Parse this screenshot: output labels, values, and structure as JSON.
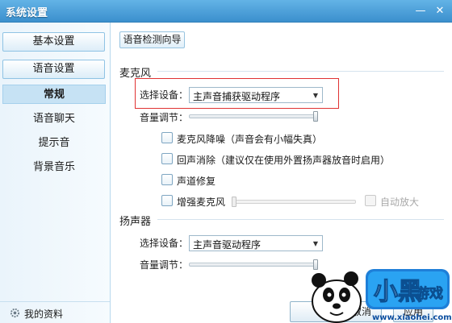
{
  "window": {
    "title": "系统设置",
    "minimize_glyph": "—",
    "close_glyph": "✕"
  },
  "sidebar": {
    "buttons": [
      {
        "label": "基本设置"
      },
      {
        "label": "语音设置"
      }
    ],
    "items": [
      {
        "label": "常规",
        "active": true
      },
      {
        "label": "语音聊天"
      },
      {
        "label": "提示音"
      },
      {
        "label": "背景音乐"
      }
    ],
    "footer": {
      "label": "我的资料",
      "icon": "gear-icon"
    }
  },
  "main": {
    "wizard_button": "语音检测向导",
    "microphone": {
      "section_title": "麦克风",
      "device_label": "选择设备：",
      "device_value": "主声音捕获驱动程序",
      "volume_label": "音量调节：",
      "volume_level": 1.0,
      "options": [
        {
          "label": "麦克风降噪（声音会有小幅失真）",
          "checked": false
        },
        {
          "label": "回声消除（建议仅在使用外置扬声器放音时启用）",
          "checked": false
        },
        {
          "label": "声道修复",
          "checked": false
        },
        {
          "label": "增强麦克风",
          "checked": false
        }
      ],
      "boost_level": 0.0,
      "auto_amplify": {
        "label": "自动放大",
        "checked": false,
        "disabled": true
      }
    },
    "speaker": {
      "section_title": "扬声器",
      "device_label": "选择设备：",
      "device_value": "主声音驱动程序",
      "volume_label": "音量调节：",
      "volume_level": 1.0
    }
  },
  "footer_buttons": [
    {
      "label": "取消"
    },
    {
      "label": "应用"
    }
  ],
  "watermark": {
    "brand_text": "小黑游戏",
    "url_text": "www.xiaohei.com"
  },
  "colors": {
    "accent": "#3b8fcd",
    "highlight_border": "#e03232"
  }
}
